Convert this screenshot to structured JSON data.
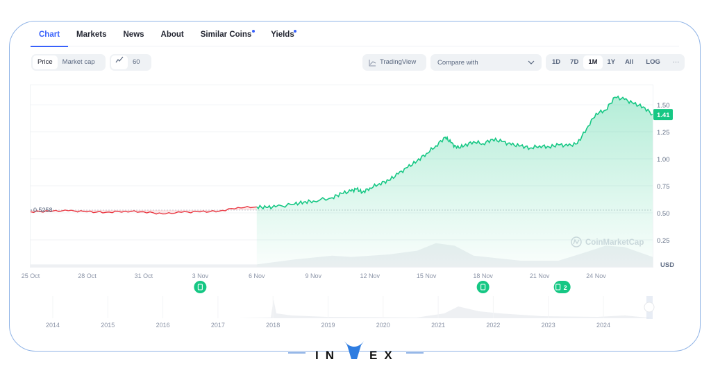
{
  "tabs": [
    {
      "label": "Chart",
      "active": true,
      "dot": false
    },
    {
      "label": "Markets",
      "active": false,
      "dot": false
    },
    {
      "label": "News",
      "active": false,
      "dot": false
    },
    {
      "label": "About",
      "active": false,
      "dot": false
    },
    {
      "label": "Similar Coins",
      "active": false,
      "dot": true
    },
    {
      "label": "Yields",
      "active": false,
      "dot": true
    }
  ],
  "toolbar": {
    "price_label": "Price",
    "market_cap_label": "Market cap",
    "line_icon": "line-chart-icon",
    "candle_label": "60",
    "tradingview_label": "TradingView",
    "compare_placeholder": "Compare with",
    "ranges": [
      "1D",
      "7D",
      "1M",
      "1Y",
      "All"
    ],
    "active_range": "1M",
    "log_label": "LOG",
    "more_label": "···"
  },
  "colors": {
    "accent": "#3861fb",
    "up": "#16c784",
    "down": "#ea3943",
    "frame": "#8fb3e6"
  },
  "chart_data": {
    "type": "line",
    "title": "",
    "currency": "USD",
    "watermark": "CoinMarketCap",
    "baseline_value": 0.5258,
    "baseline_label": "0.5258",
    "current_value": 1.41,
    "current_label": "1.41",
    "y_ticks": [
      "0.25",
      "0.50",
      "0.75",
      "1.00",
      "1.25",
      "1.50"
    ],
    "ylim": [
      0.0,
      1.68
    ],
    "x_ticks": [
      "25 Oct",
      "28 Oct",
      "31 Oct",
      "3 Nov",
      "6 Nov",
      "9 Nov",
      "12 Nov",
      "15 Nov",
      "18 Nov",
      "21 Nov",
      "24 Nov"
    ],
    "series": [
      {
        "name": "Price",
        "x_days": [
          0,
          1,
          2,
          3,
          4,
          5,
          6,
          7,
          8,
          9,
          10,
          11,
          12,
          12.5,
          13,
          14,
          14.5,
          15,
          16,
          16.5,
          17,
          17.3,
          17.6,
          18,
          18.5,
          19,
          19.5,
          20,
          20.5,
          21,
          21.5,
          22,
          22.3,
          22.6,
          23,
          23.5,
          24,
          24.5,
          25,
          25.5,
          26,
          26.5,
          27,
          27.5,
          28,
          28.5,
          29,
          29.5,
          30,
          30.5,
          31,
          31.5,
          32,
          32.5,
          33
        ],
        "values": [
          0.51,
          0.515,
          0.52,
          0.51,
          0.505,
          0.515,
          0.51,
          0.49,
          0.505,
          0.51,
          0.515,
          0.55,
          0.555,
          0.55,
          0.555,
          0.58,
          0.6,
          0.61,
          0.64,
          0.68,
          0.7,
          0.72,
          0.69,
          0.73,
          0.77,
          0.8,
          0.86,
          0.92,
          0.98,
          1.05,
          1.12,
          1.2,
          1.15,
          1.1,
          1.12,
          1.16,
          1.14,
          1.18,
          1.16,
          1.13,
          1.12,
          1.1,
          1.12,
          1.11,
          1.13,
          1.12,
          1.14,
          1.28,
          1.42,
          1.45,
          1.57,
          1.55,
          1.51,
          1.48,
          1.41
        ]
      }
    ],
    "news_markers": [
      {
        "date": "3 Nov",
        "count": ""
      },
      {
        "date": "18 Nov",
        "count": ""
      },
      {
        "date": "22 Nov",
        "count": "2"
      }
    ],
    "navigator_years": [
      "2014",
      "2015",
      "2016",
      "2017",
      "2018",
      "2019",
      "2020",
      "2021",
      "2022",
      "2023",
      "2024"
    ]
  },
  "brand": {
    "left": "IN",
    "mid": "V",
    "right": "EX"
  }
}
